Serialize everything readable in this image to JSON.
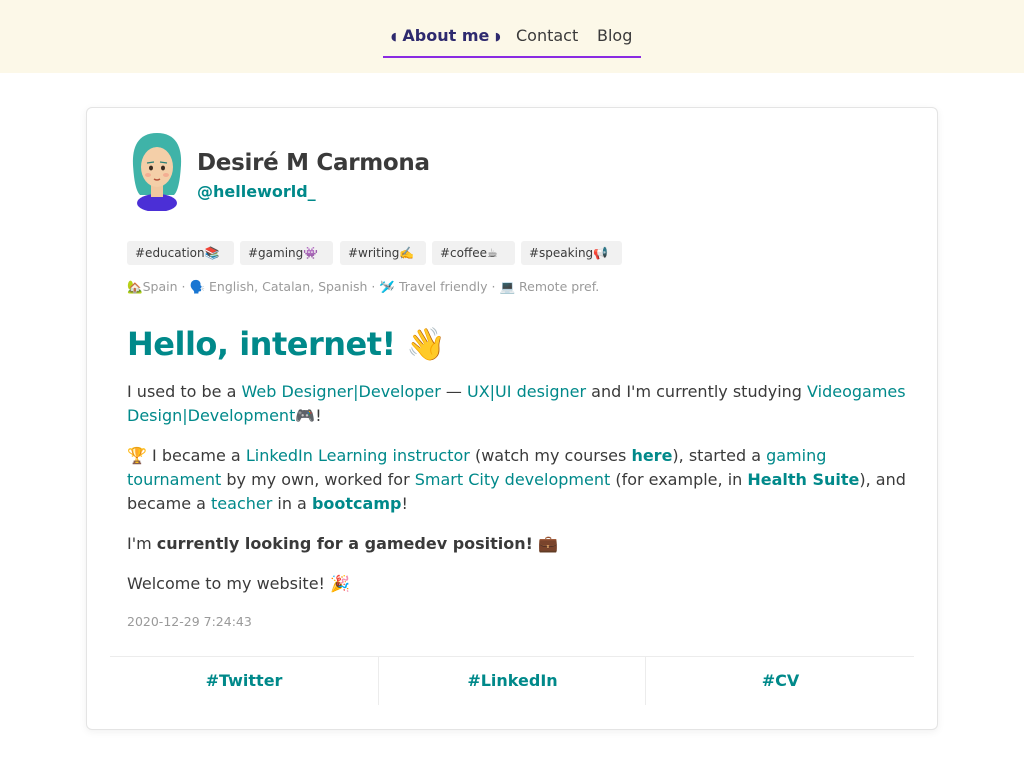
{
  "nav": {
    "about": "About me",
    "contact": "Contact",
    "blog": "Blog",
    "moon_left": "◖",
    "moon_right": "◗"
  },
  "profile": {
    "name": "Desiré M Carmona",
    "handle": "@helleworld_"
  },
  "tags": [
    {
      "text": "#education",
      "emoji": "📚"
    },
    {
      "text": "#gaming",
      "emoji": "👾"
    },
    {
      "text": "#writing",
      "emoji": "✍️"
    },
    {
      "text": "#coffee",
      "emoji": "☕"
    },
    {
      "text": "#speaking",
      "emoji": "📢"
    }
  ],
  "facts": {
    "home_emoji": "🏡",
    "location": "Spain",
    "speech_emoji": "🗣️",
    "languages": "English, Catalan, Spanish",
    "travel_emoji": "🛩️",
    "travel": "Travel friendly",
    "laptop_emoji": "💻",
    "remote": "Remote pref.",
    "separator": "·"
  },
  "greeting": {
    "text": "Hello, internet!",
    "emoji": "👋"
  },
  "paragraph1": {
    "t1": "I used to be a ",
    "link1": "Web Designer|Developer",
    "t2": " — ",
    "link2": "UX|UI designer",
    "t3": " and I'm currently studying ",
    "link3": "Videogames Design|Development",
    "emoji": "🎮",
    "t4": "!"
  },
  "paragraph2": {
    "emoji": "🏆",
    "t1": " I became a ",
    "link1": "LinkedIn Learning instructor",
    "t2": " (watch my courses ",
    "link2": "here",
    "t3": "), started a ",
    "link3": "gaming tournament",
    "t4": " by my own, worked for ",
    "link4": "Smart City development",
    "t5": " (for example, in ",
    "link5": "Health Suite",
    "t6": "), and became a ",
    "link6": "teacher",
    "t7": " in a ",
    "link7": "bootcamp",
    "t8": "!"
  },
  "paragraph3": {
    "t1": "I'm ",
    "bold": "currently looking for a gamedev position!",
    "emoji": "💼"
  },
  "paragraph4": {
    "text": "Welcome to my website!",
    "emoji": "🎉"
  },
  "timestamp": "2020-12-29 7:24:43",
  "footer": {
    "twitter": "#Twitter",
    "linkedin": "#LinkedIn",
    "cv": "#CV"
  },
  "colors": {
    "accent": "#00898a",
    "nav_active": "#2e2a6e",
    "nav_underline": "#8a2be2",
    "topbar_bg": "#fcf8e8"
  }
}
